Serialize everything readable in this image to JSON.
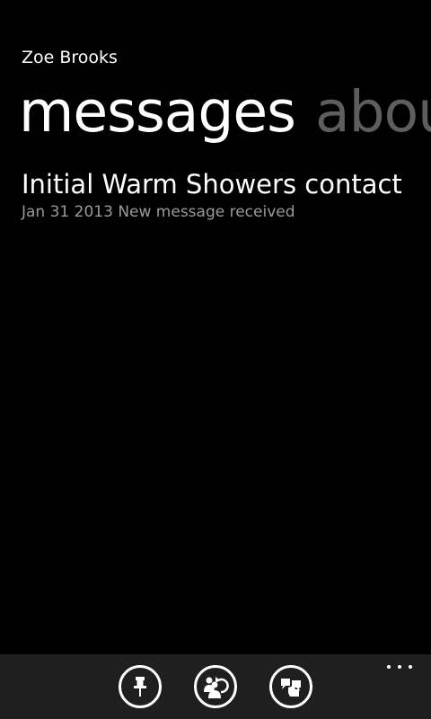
{
  "app": {
    "title": "Zoe Brooks"
  },
  "pivot": {
    "items": [
      {
        "label": "messages",
        "active": true
      },
      {
        "label": "about",
        "active": false
      }
    ]
  },
  "messages": [
    {
      "subject": "Initial Warm Showers contact",
      "meta": "Jan 31 2013 New message received"
    }
  ],
  "app_bar": {
    "buttons": [
      {
        "icon": "pin-icon"
      },
      {
        "icon": "reply-icon"
      },
      {
        "icon": "feedback-icon"
      }
    ],
    "more_icon": "ellipsis-icon"
  },
  "colors": {
    "background": "#000000",
    "foreground": "#ffffff",
    "inactive_header": "#5e5e5e",
    "subtle_text": "#9a9a9a",
    "app_bar": "#1f1f1f"
  }
}
